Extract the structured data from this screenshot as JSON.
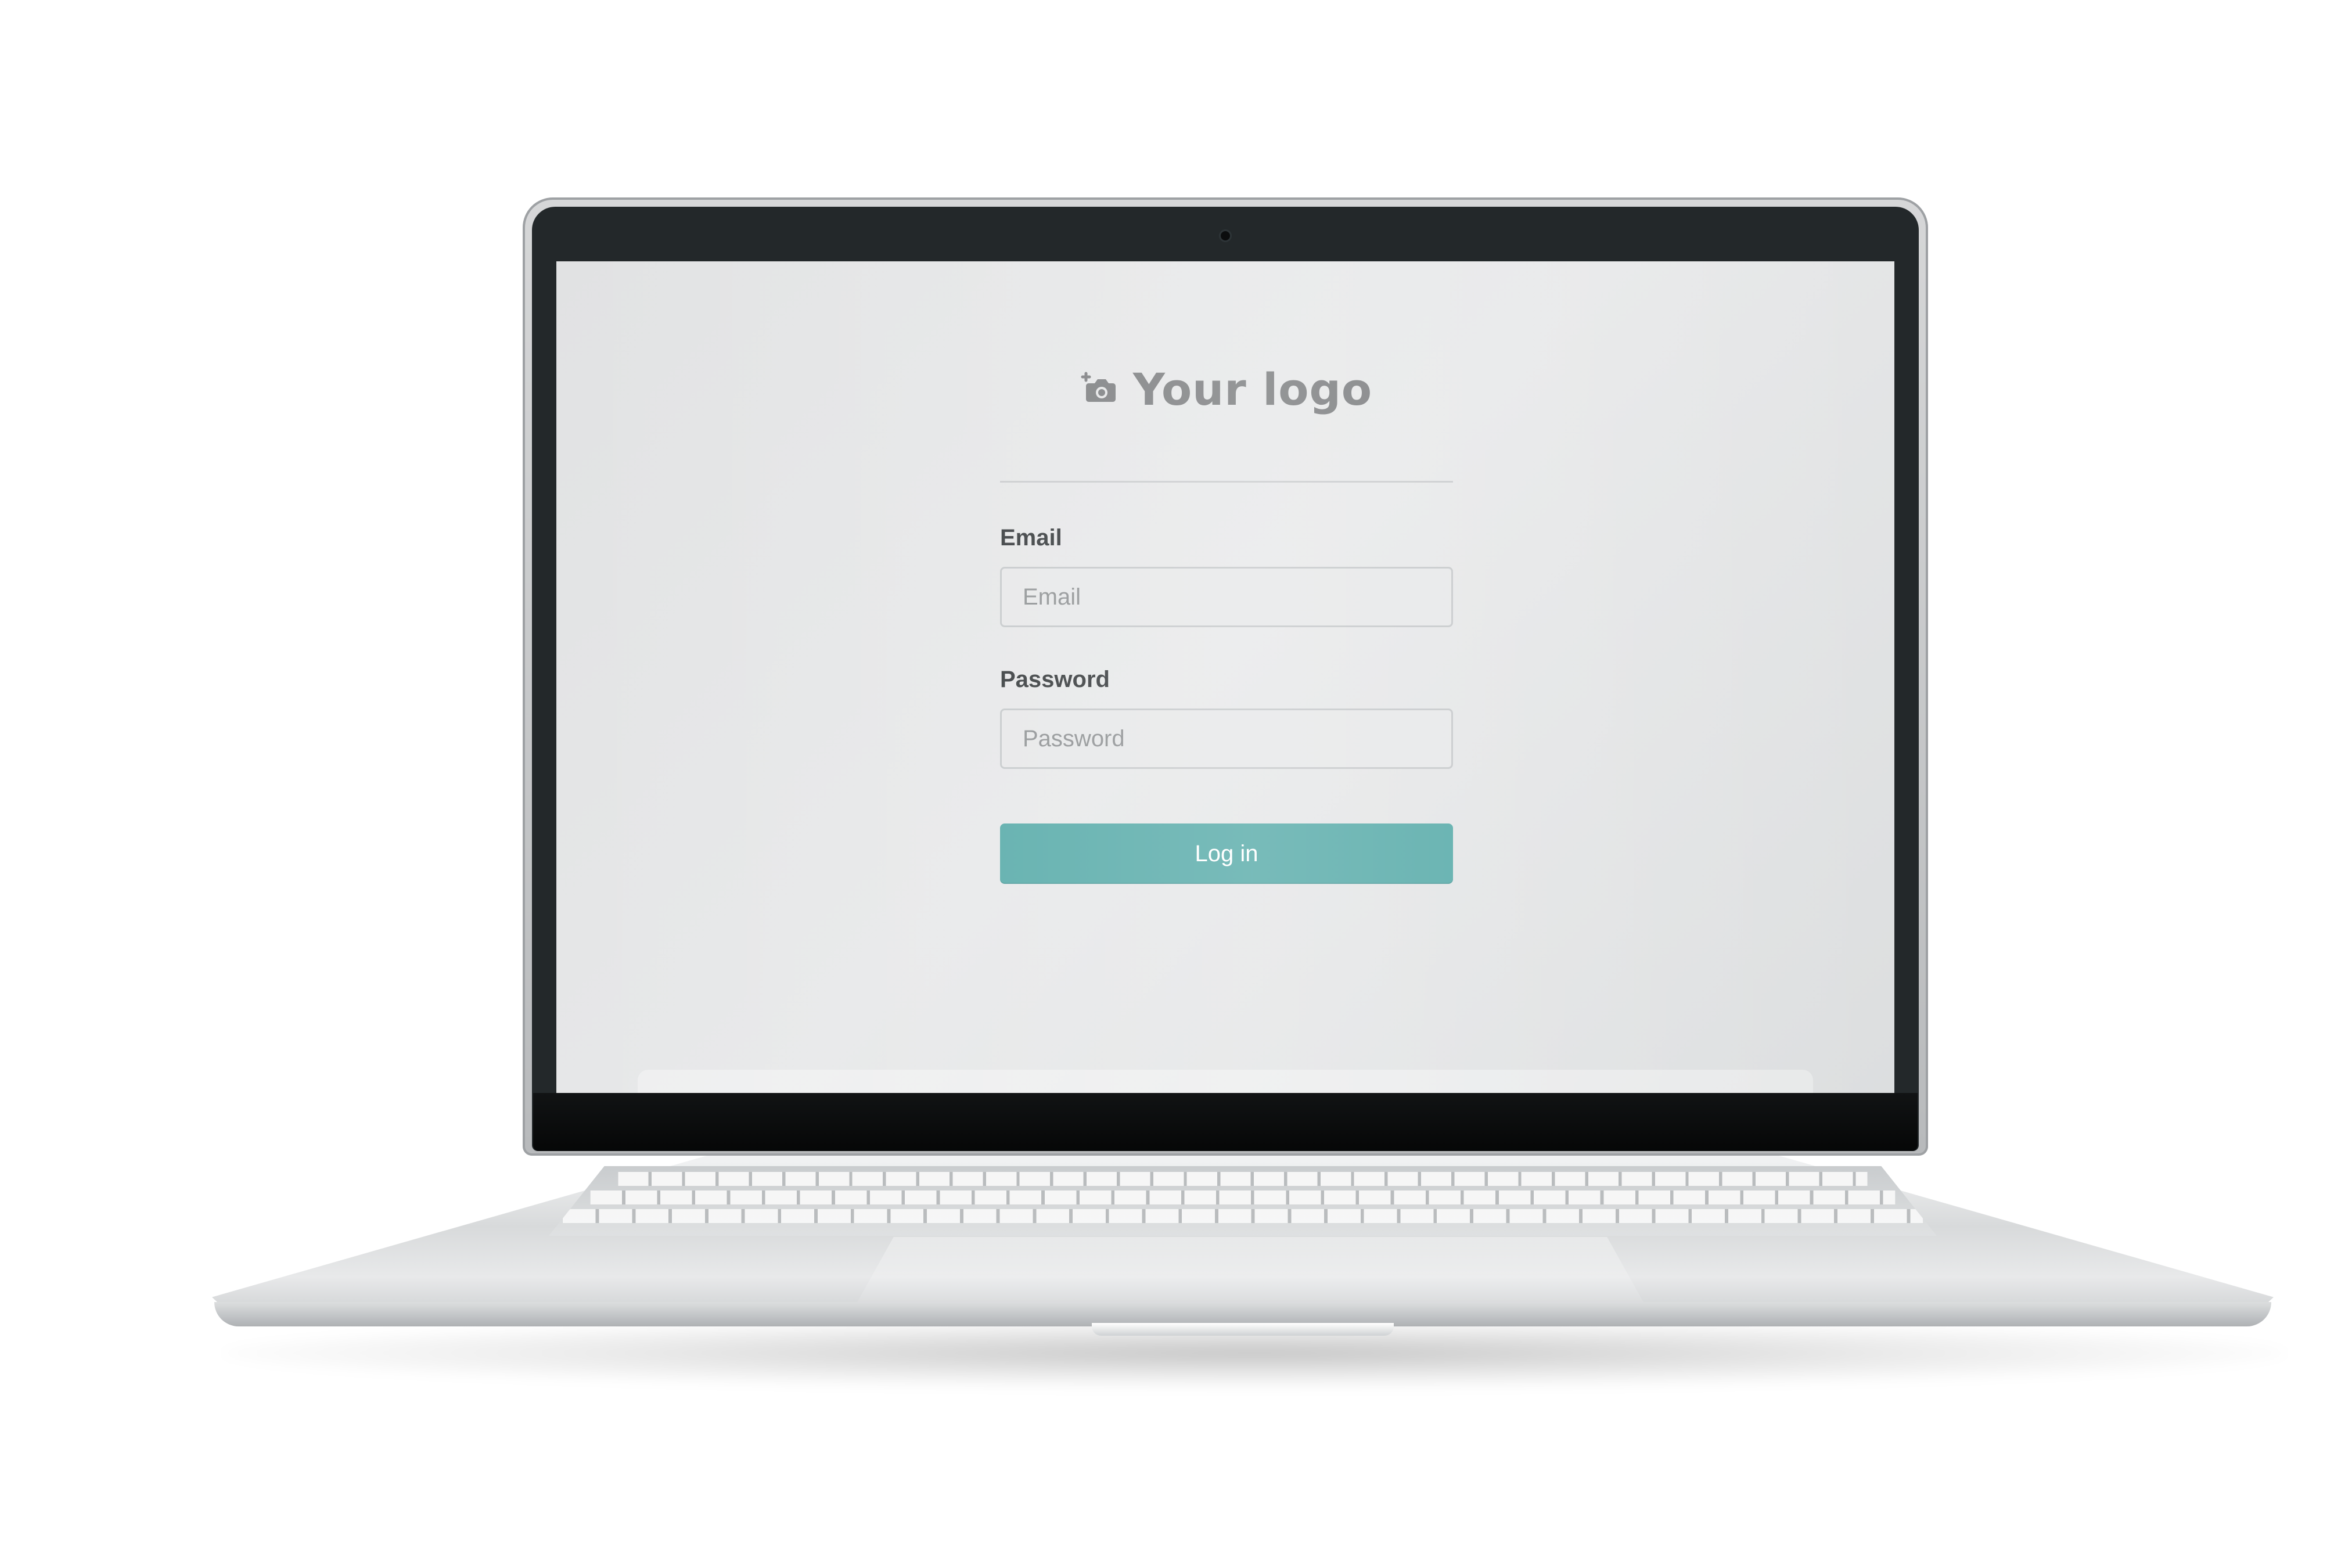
{
  "logo": {
    "icon": "camera-plus-icon",
    "text": "Your logo"
  },
  "form": {
    "email_label": "Email",
    "email_placeholder": "Email",
    "password_label": "Password",
    "password_placeholder": "Password",
    "login_button": "Log in"
  },
  "colors": {
    "accent": "#52A8A6",
    "label_text": "#2F3335",
    "screen_background": "#E3E4E5"
  }
}
